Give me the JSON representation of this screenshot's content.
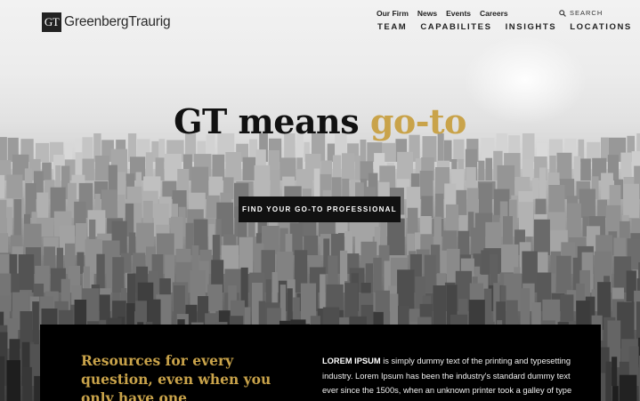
{
  "header": {
    "logo_mark": "GT",
    "logo_name": "GreenbergTraurig",
    "top_links": [
      "Our Firm",
      "News",
      "Events",
      "Careers"
    ],
    "search_label": "SEARCH",
    "search_icon": "search-icon",
    "nav": [
      "TEAM",
      "CAPABILITES",
      "INSIGHTS",
      "LOCATIONS"
    ]
  },
  "hero": {
    "headline_main": "GT means ",
    "headline_accent": "go-to",
    "cta_label": "FIND YOUR GO-TO PROFESSIONAL"
  },
  "resources": {
    "title": "Resources for every question, even when you only have one",
    "body_lead": "LOREM IPSUM",
    "body_text": " is simply dummy text of the printing and typesetting industry. Lorem Ipsum has been the industry's standard dummy text ever since the 1500s, when an unknown printer took a galley of type"
  },
  "colors": {
    "accent": "#c9a34a",
    "dark": "#111111"
  }
}
